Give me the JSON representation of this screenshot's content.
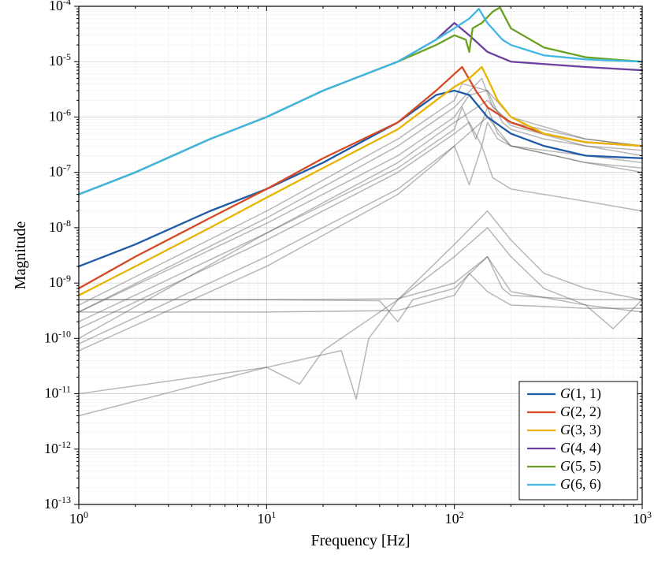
{
  "chart_data": {
    "type": "line",
    "title": "",
    "xlabel": "Frequency [Hz]",
    "ylabel": "Magnitude",
    "xscale": "log",
    "yscale": "log",
    "xlim": [
      1,
      1000
    ],
    "ylim": [
      1e-13,
      0.0001
    ],
    "xticks_major": [
      1,
      10,
      100,
      1000
    ],
    "xticks_labels": [
      "10⁰",
      "10¹",
      "10²",
      "10³"
    ],
    "yticks_exp": [
      -13,
      -12,
      -11,
      -10,
      -9,
      -8,
      -7,
      -6,
      -5,
      -4
    ],
    "legend_pos": "lower-right",
    "series": [
      {
        "name": "G(1,1)",
        "color": "#1f5aa6",
        "x": [
          1,
          2,
          5,
          10,
          20,
          50,
          80,
          100,
          120,
          150,
          200,
          300,
          500,
          1000
        ],
        "y": [
          2e-09,
          5e-09,
          2e-08,
          5e-08,
          1.5e-07,
          8e-07,
          2.5e-06,
          3e-06,
          2.5e-06,
          1e-06,
          5e-07,
          3e-07,
          2e-07,
          1.8e-07
        ]
      },
      {
        "name": "G(2,2)",
        "color": "#d64922",
        "x": [
          1,
          2,
          5,
          10,
          20,
          50,
          80,
          100,
          110,
          130,
          150,
          200,
          300,
          500,
          1000
        ],
        "y": [
          8e-10,
          3e-09,
          1.5e-08,
          5e-08,
          1.8e-07,
          8e-07,
          3e-06,
          6e-06,
          8e-06,
          3e-06,
          1.5e-06,
          8e-07,
          5e-07,
          3.5e-07,
          3e-07
        ]
      },
      {
        "name": "G(3,3)",
        "color": "#e8b400",
        "x": [
          1,
          2,
          5,
          10,
          20,
          50,
          80,
          100,
          120,
          140,
          150,
          170,
          200,
          300,
          500,
          1000
        ],
        "y": [
          6e-10,
          2e-09,
          1e-08,
          3.5e-08,
          1.2e-07,
          6e-07,
          2e-06,
          3.5e-06,
          5e-06,
          8e-06,
          5e-06,
          2e-06,
          1e-06,
          5e-07,
          3.5e-07,
          3e-07
        ]
      },
      {
        "name": "G(4,4)",
        "color": "#6a3fa0",
        "x": [
          1,
          2,
          5,
          10,
          20,
          50,
          80,
          100,
          120,
          150,
          200,
          500,
          1000
        ],
        "y": [
          4e-08,
          1e-07,
          4e-07,
          1e-06,
          3e-06,
          1e-05,
          2.5e-05,
          5e-05,
          3e-05,
          1.5e-05,
          1e-05,
          8e-06,
          7e-06
        ]
      },
      {
        "name": "G(5,5)",
        "color": "#6aa121",
        "x": [
          1,
          2,
          5,
          10,
          20,
          50,
          80,
          100,
          115,
          120,
          125,
          140,
          160,
          175,
          200,
          300,
          500,
          1000
        ],
        "y": [
          4e-08,
          1e-07,
          4e-07,
          1e-06,
          3e-06,
          1e-05,
          2e-05,
          3e-05,
          2.5e-05,
          1.5e-05,
          4e-05,
          5e-05,
          8e-05,
          9.5e-05,
          4e-05,
          1.8e-05,
          1.2e-05,
          1e-05
        ]
      },
      {
        "name": "G(6,6)",
        "color": "#3fb7e4",
        "x": [
          1,
          2,
          5,
          10,
          20,
          50,
          80,
          100,
          120,
          135,
          150,
          180,
          200,
          300,
          500,
          1000
        ],
        "y": [
          4e-08,
          1e-07,
          4e-07,
          1e-06,
          3e-06,
          1e-05,
          2.5e-05,
          4e-05,
          6e-05,
          9e-05,
          5e-05,
          2.5e-05,
          2e-05,
          1.3e-05,
          1.1e-05,
          1e-05
        ]
      }
    ],
    "coupling_series": [
      {
        "x": [
          1,
          10,
          50,
          100,
          110,
          150,
          200,
          500,
          1000
        ],
        "y": [
          4e-10,
          2e-08,
          4e-07,
          2e-06,
          4e-06,
          3e-06,
          1e-06,
          4e-07,
          3e-07
        ]
      },
      {
        "x": [
          1,
          10,
          50,
          100,
          140,
          160,
          200,
          500,
          1000
        ],
        "y": [
          3e-10,
          1.5e-08,
          3e-07,
          1.5e-06,
          5e-06,
          1.5e-06,
          8e-07,
          4e-07,
          3e-07
        ]
      },
      {
        "x": [
          1,
          10,
          50,
          100,
          150,
          200,
          500,
          1000
        ],
        "y": [
          2e-10,
          8e-09,
          1.5e-07,
          8e-07,
          2e-06,
          7e-07,
          3e-07,
          2e-07
        ]
      },
      {
        "x": [
          1,
          10,
          40,
          50,
          60,
          100,
          150,
          200,
          500,
          1000
        ],
        "y": [
          5e-10,
          5e-10,
          4.8e-10,
          2e-10,
          5e-10,
          8e-10,
          3e-09,
          7e-10,
          4e-10,
          3e-10
        ]
      },
      {
        "x": [
          1,
          10,
          50,
          100,
          110,
          130,
          150,
          170,
          200,
          500,
          1000
        ],
        "y": [
          1e-10,
          8e-09,
          1.2e-07,
          6e-07,
          1.5e-06,
          4e-07,
          1.5e-06,
          5e-07,
          3e-07,
          2e-07,
          1.5e-07
        ]
      },
      {
        "x": [
          1,
          10,
          50,
          100,
          150,
          200,
          500,
          1000
        ],
        "y": [
          8e-11,
          3e-09,
          5e-08,
          3e-07,
          1e-06,
          3e-07,
          1.5e-07,
          1e-07
        ]
      },
      {
        "x": [
          1,
          10,
          25,
          30,
          35,
          50,
          100,
          150,
          200,
          300,
          500,
          1000
        ],
        "y": [
          1e-11,
          3e-11,
          6e-11,
          8e-12,
          1e-10,
          5e-10,
          5e-09,
          2e-08,
          6e-09,
          1.5e-09,
          8e-10,
          5e-10
        ]
      },
      {
        "x": [
          1,
          10,
          50,
          100,
          120,
          150,
          200,
          200,
          500,
          1000
        ],
        "y": [
          3e-10,
          3e-10,
          3.2e-10,
          6e-10,
          1.5e-09,
          7e-10,
          4e-10,
          4e-10,
          3.5e-10,
          3.5e-10
        ]
      },
      {
        "x": [
          1,
          10,
          50,
          80,
          100,
          120,
          140,
          160,
          200,
          500,
          1000
        ],
        "y": [
          6e-11,
          2e-09,
          4e-08,
          1.5e-07,
          3e-07,
          6e-08,
          3e-07,
          8e-08,
          5e-08,
          3e-08,
          2e-08
        ]
      },
      {
        "x": [
          1,
          10,
          15,
          20,
          50,
          100,
          150,
          200,
          300,
          500,
          700,
          1000
        ],
        "y": [
          4e-12,
          3e-11,
          1.5e-11,
          6e-11,
          5e-10,
          3e-09,
          1e-08,
          3e-09,
          8e-10,
          4e-10,
          1.5e-10,
          5e-10
        ]
      },
      {
        "x": [
          1,
          10,
          50,
          100,
          120,
          140,
          150,
          170,
          200,
          500,
          1000
        ],
        "y": [
          1.5e-10,
          6e-09,
          1e-07,
          5e-07,
          8e-07,
          3e-07,
          8e-07,
          4e-07,
          3e-07,
          1.5e-07,
          1.2e-07
        ]
      },
      {
        "x": [
          1,
          10,
          50,
          100,
          150,
          180,
          200,
          500,
          1000
        ],
        "y": [
          5e-10,
          5e-10,
          5.2e-10,
          1e-09,
          3e-09,
          8e-10,
          6e-10,
          5e-10,
          5e-10
        ]
      },
      {
        "x": [
          1,
          10,
          50,
          100,
          120,
          150,
          180,
          200,
          300,
          500,
          1000
        ],
        "y": [
          3e-10,
          1.2e-08,
          2e-07,
          1e-06,
          2.5e-06,
          3e-06,
          8e-07,
          6e-07,
          4e-07,
          3e-07,
          2.5e-07
        ]
      }
    ]
  }
}
